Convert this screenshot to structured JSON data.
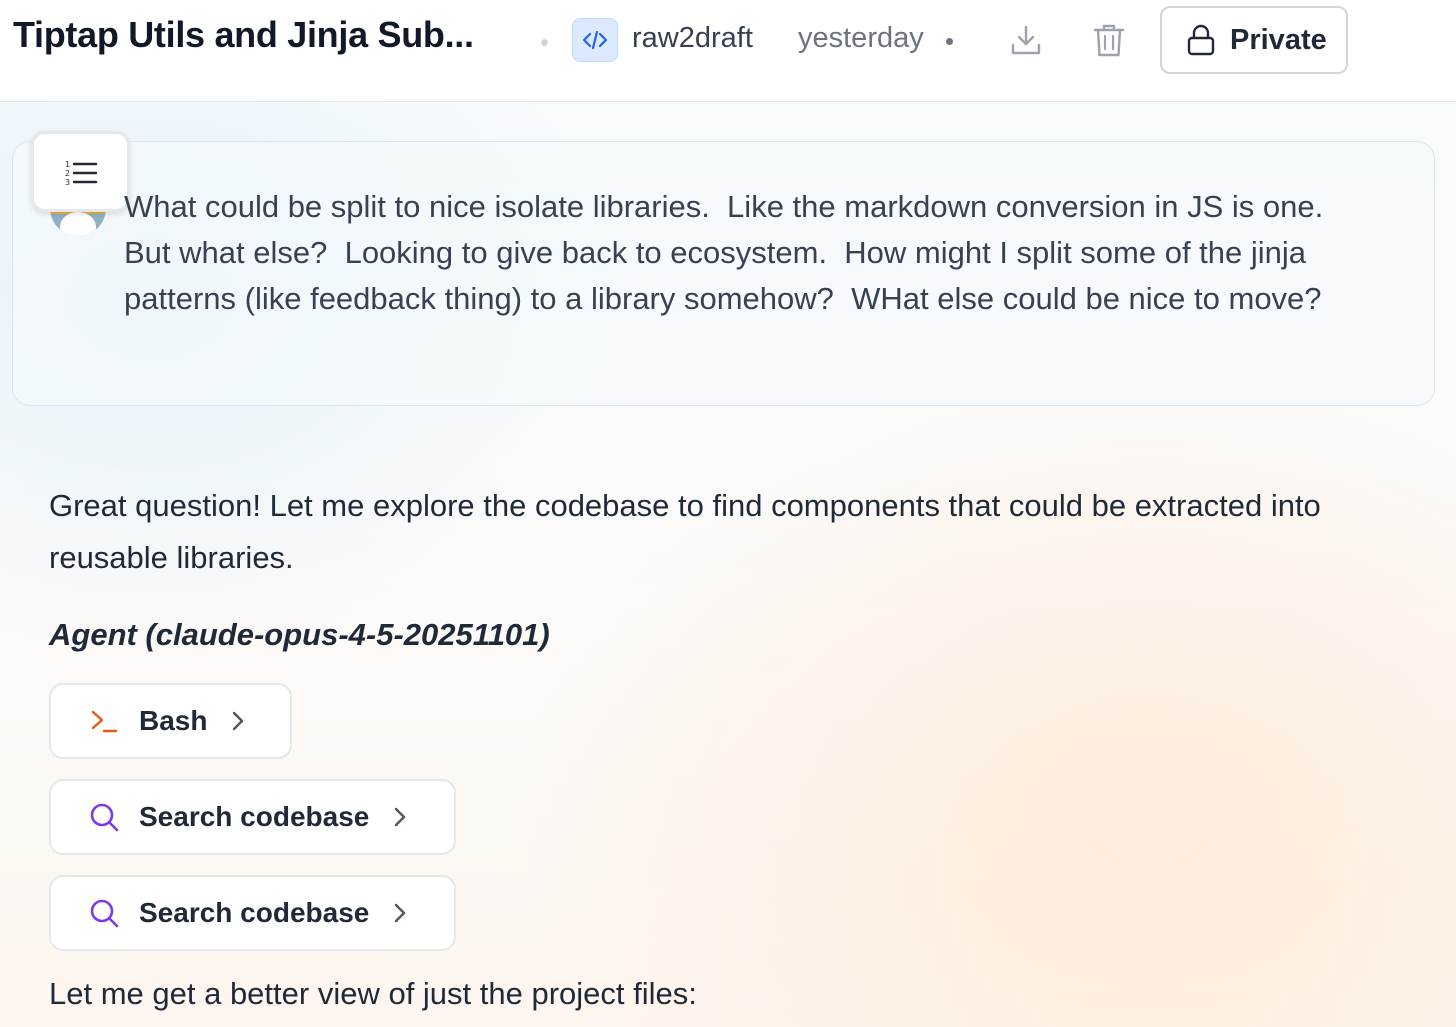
{
  "header": {
    "title": "Tiptap Utils and Jinja Sub...",
    "project_icon": "code-icon",
    "project_name": "raw2draft",
    "timestamp": "yesterday",
    "download_icon": "download-icon",
    "delete_icon": "trash-icon",
    "visibility_label": "Private",
    "visibility_icon": "lock-icon"
  },
  "user_message": {
    "text": "What could be split to nice isolate libraries.  Like the markdown conversion in JS is one.  But what else?  Looking to give back to ecosystem.  How might I split some of the jinja patterns (like feedback thing) to a library somehow?  WHat else could be nice to move?"
  },
  "assistant": {
    "intro": "Great question! Let me explore the codebase to find components that could be extracted into reusable libraries.",
    "agent_heading": "Agent (claude-opus-4-5-20251101)",
    "tools": [
      {
        "label": "Bash",
        "icon": "terminal-icon",
        "color": "#ea580c"
      },
      {
        "label": "Search codebase",
        "icon": "search-icon",
        "color": "#7c3aed"
      },
      {
        "label": "Search codebase",
        "icon": "search-icon",
        "color": "#7c3aed"
      }
    ],
    "followup": "Let me get a better view of just the project files:"
  },
  "colors": {
    "accent_blue": "#2563eb",
    "terminal_orange": "#ea580c",
    "search_purple": "#7c3aed"
  }
}
